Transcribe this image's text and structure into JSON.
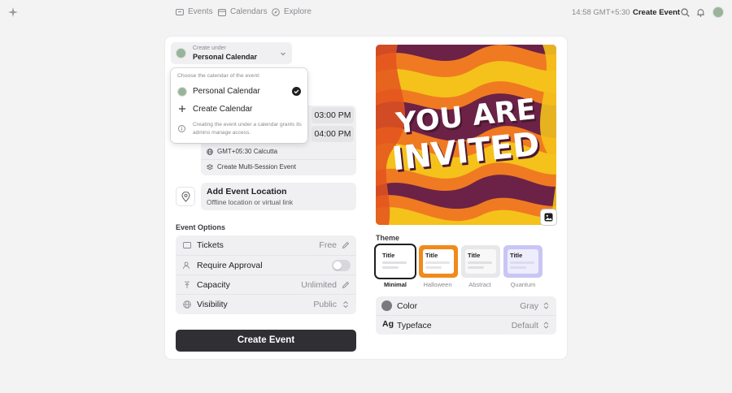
{
  "nav": {
    "events": "Events",
    "calendars": "Calendars",
    "explore": "Explore",
    "time": "14:58 GMT+5:30",
    "create_event": "Create Event"
  },
  "calendar_select": {
    "sub_label": "Create under",
    "value": "Personal Calendar"
  },
  "dropdown": {
    "heading": "Choose the calendar of the event:",
    "options": [
      {
        "label": "Personal Calendar",
        "selected": true
      },
      {
        "label": "Create Calendar"
      }
    ],
    "info": "Creating the event under a calendar grants its admins manage access."
  },
  "time": {
    "start_time": "03:00 PM",
    "end_time": "04:00 PM",
    "timezone": "GMT+05:30 Calcutta",
    "multi_session": "Create Multi-Session Event"
  },
  "location": {
    "title": "Add Event Location",
    "subtitle": "Offline location or virtual link"
  },
  "event_options": {
    "label": "Event Options",
    "rows": [
      {
        "label": "Tickets",
        "value": "Free"
      },
      {
        "label": "Require Approval",
        "toggle": false
      },
      {
        "label": "Capacity",
        "value": "Unlimited"
      },
      {
        "label": "Visibility",
        "value": "Public"
      }
    ]
  },
  "create_button": "Create Event",
  "invite_image": {
    "line1": "YOU ARE",
    "line2": "INVITED"
  },
  "theme": {
    "label": "Theme",
    "options": [
      {
        "title": "Title",
        "name": "Minimal",
        "selected": true
      },
      {
        "title": "Title",
        "name": "Halloween"
      },
      {
        "title": "Title",
        "name": "Abstract"
      },
      {
        "title": "Title",
        "name": "Quantum"
      }
    ]
  },
  "settings": {
    "color_label": "Color",
    "color_value": "Gray",
    "typeface_icon": "Ag",
    "typeface_label": "Typeface",
    "typeface_value": "Default"
  },
  "colors": {
    "button_dark": "#303034",
    "panel_bg": "#f0f0f2",
    "halloween": "#f08a1c",
    "quantum": "#c9c6f5"
  }
}
